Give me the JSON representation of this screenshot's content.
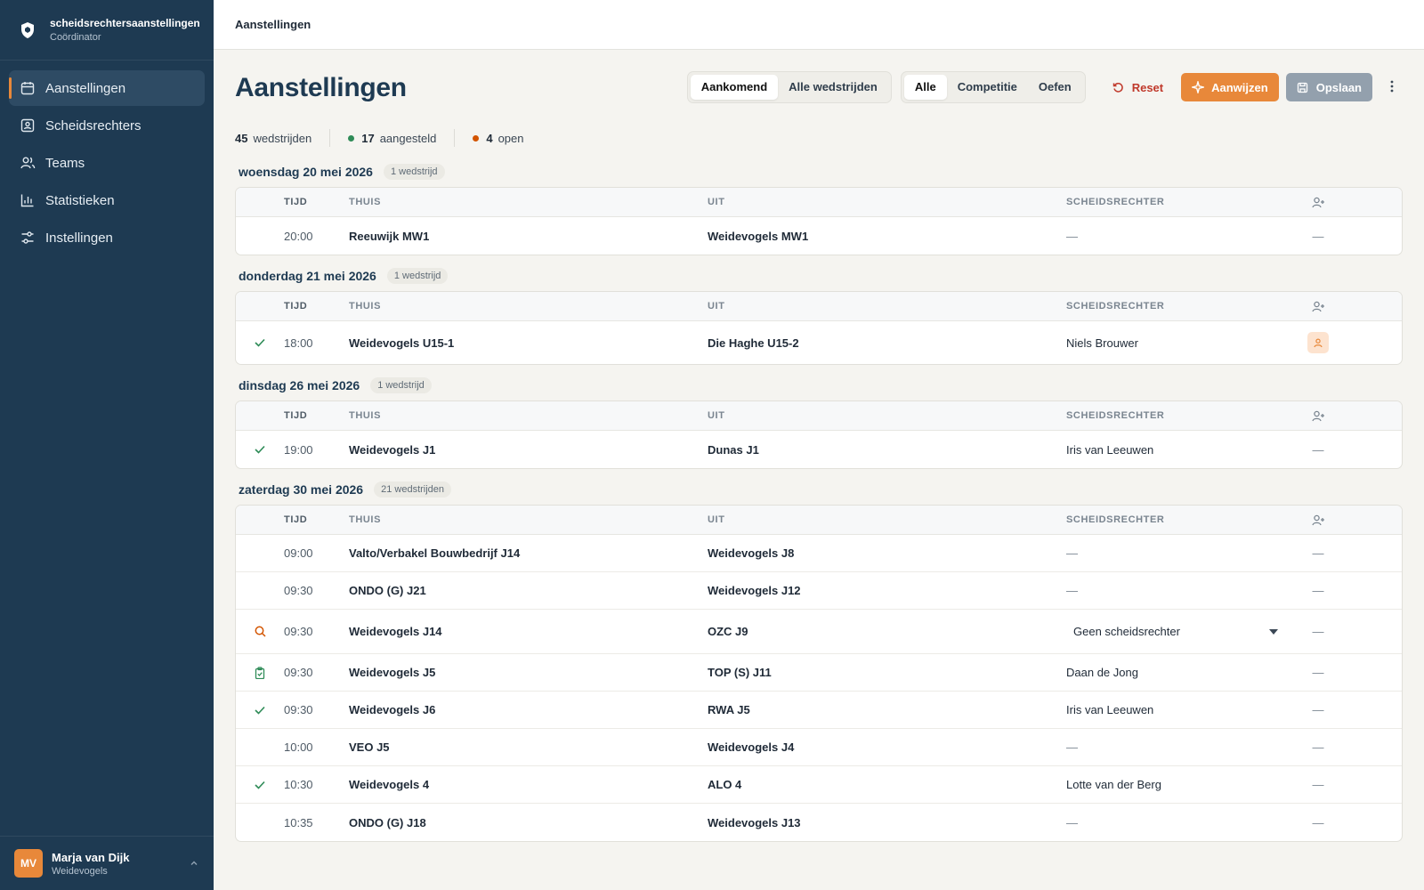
{
  "app": {
    "name": "scheidsrechtersaanstellingen",
    "role": "Coördinator"
  },
  "nav": [
    {
      "label": "Aanstellingen",
      "icon": "calendar-icon",
      "active": true
    },
    {
      "label": "Scheidsrechters",
      "icon": "id-card-icon",
      "active": false
    },
    {
      "label": "Teams",
      "icon": "users-icon",
      "active": false
    },
    {
      "label": "Statistieken",
      "icon": "bar-chart-icon",
      "active": false
    },
    {
      "label": "Instellingen",
      "icon": "sliders-icon",
      "active": false
    }
  ],
  "user": {
    "initials": "MV",
    "name": "Marja van Dijk",
    "org": "Weidevogels"
  },
  "topbar": {
    "title": "Aanstellingen"
  },
  "page": {
    "title": "Aanstellingen"
  },
  "filters": {
    "period": [
      "Aankomend",
      "Alle wedstrijden"
    ],
    "period_active": "Aankomend",
    "type": [
      "Alle",
      "Competitie",
      "Oefen"
    ],
    "type_active": "Alle"
  },
  "buttons": {
    "reset": "Reset",
    "assign": "Aanwijzen",
    "save": "Opslaan"
  },
  "stats": {
    "matches_count": "45",
    "matches_label": "wedstrijden",
    "assigned_count": "17",
    "assigned_label": "aangesteld",
    "open_count": "4",
    "open_label": "open"
  },
  "colors": {
    "accent": "#e8883a",
    "sidebar": "#1e3a52",
    "assigned": "#2e8b57",
    "open": "#d35400",
    "reset": "#c0392b"
  },
  "columns": {
    "time": "TIJD",
    "home": "THUIS",
    "away": "UIT",
    "referee": "SCHEIDSRECHTER",
    "action_icon": "user-plus-icon"
  },
  "groups": [
    {
      "date": "woensdag 20 mei 2026",
      "count": "1 wedstrijd",
      "rows": [
        {
          "status": "",
          "time": "20:00",
          "home": "Reeuwijk MW1",
          "away": "Weidevogels MW1",
          "referee": "—",
          "action": "—"
        }
      ]
    },
    {
      "date": "donderdag 21 mei 2026",
      "count": "1 wedstrijd",
      "rows": [
        {
          "status": "check",
          "time": "18:00",
          "home": "Weidevogels U15-1",
          "away": "Die Haghe U15-2",
          "referee": "Niels Brouwer",
          "action": "badge"
        }
      ]
    },
    {
      "date": "dinsdag 26 mei 2026",
      "count": "1 wedstrijd",
      "rows": [
        {
          "status": "check",
          "time": "19:00",
          "home": "Weidevogels J1",
          "away": "Dunas J1",
          "referee": "Iris van Leeuwen",
          "action": "—"
        }
      ]
    },
    {
      "date": "zaterdag 30 mei 2026",
      "count": "21 wedstrijden",
      "rows": [
        {
          "status": "",
          "time": "09:00",
          "home": "Valto/Verbakel Bouwbedrijf J14",
          "away": "Weidevogels J8",
          "referee": "—",
          "action": "—"
        },
        {
          "status": "",
          "time": "09:30",
          "home": "ONDO (G) J21",
          "away": "Weidevogels J12",
          "referee": "—",
          "action": "—"
        },
        {
          "status": "search",
          "time": "09:30",
          "home": "Weidevogels J14",
          "away": "OZC J9",
          "referee": "Geen scheidsrechter",
          "referee_select": true,
          "action": "—"
        },
        {
          "status": "clipboard",
          "time": "09:30",
          "home": "Weidevogels J5",
          "away": "TOP (S) J11",
          "referee": "Daan de Jong",
          "action": "—"
        },
        {
          "status": "check",
          "time": "09:30",
          "home": "Weidevogels J6",
          "away": "RWA J5",
          "referee": "Iris van Leeuwen",
          "action": "—"
        },
        {
          "status": "",
          "time": "10:00",
          "home": "VEO J5",
          "away": "Weidevogels J4",
          "referee": "—",
          "action": "—"
        },
        {
          "status": "check",
          "time": "10:30",
          "home": "Weidevogels 4",
          "away": "ALO 4",
          "referee": "Lotte van der Berg",
          "action": "—"
        },
        {
          "status": "",
          "time": "10:35",
          "home": "ONDO (G) J18",
          "away": "Weidevogels J13",
          "referee": "—",
          "action": "—"
        }
      ]
    }
  ]
}
